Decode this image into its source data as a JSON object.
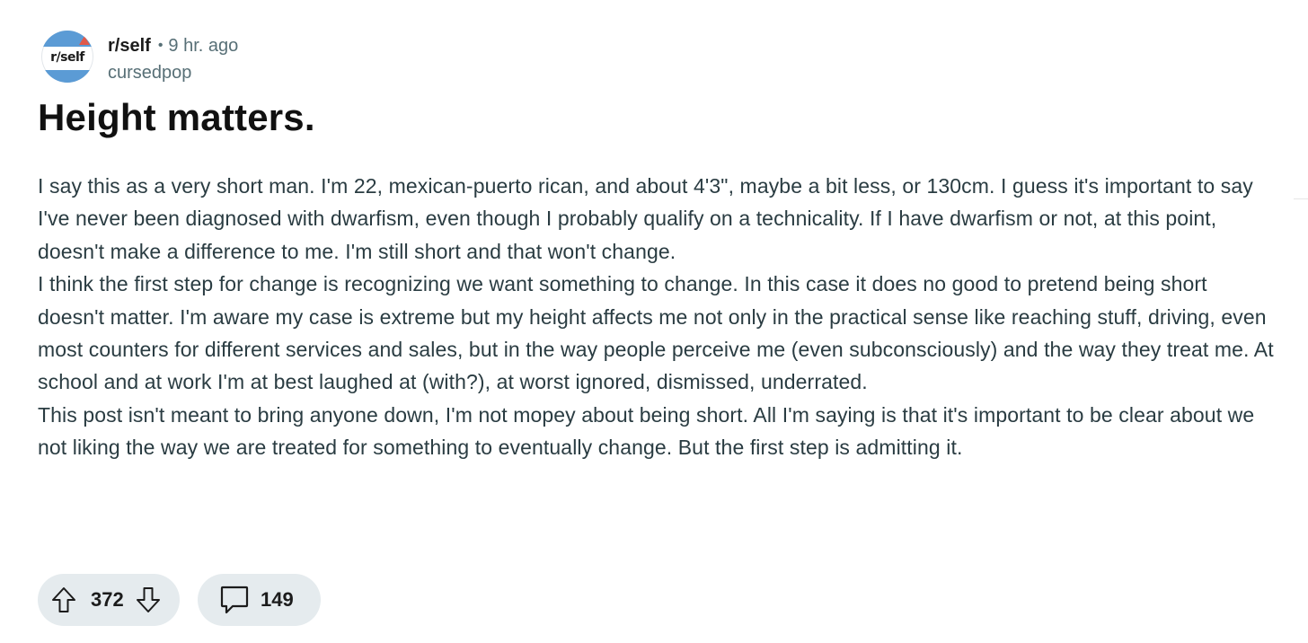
{
  "post": {
    "subreddit": "r/self",
    "avatar_text": "r/self",
    "separator": "•",
    "time_ago": "9 hr. ago",
    "author": "cursedpop",
    "title": "Height matters.",
    "body": [
      "I say this as a very short man. I'm 22, mexican-puerto rican, and about 4'3\", maybe a bit less, or 130cm. I guess it's important to say I've never been diagnosed with dwarfism, even though I probably qualify on a technicality. If I have dwarfism or not, at this point, doesn't make a difference to me. I'm still short and that won't change.",
      "I think the first step for change is recognizing we want something to change. In this case it does no good to pretend being short doesn't matter. I'm aware my case is extreme but my height affects me not only in the practical sense like reaching stuff, driving, even most counters for different services and sales, but in the way people perceive me (even subconsciously) and the way they treat me. At school and at work I'm at best laughed at (with?), at worst ignored, dismissed, underrated.",
      "This post isn't meant to bring anyone down, I'm not mopey about being short. All I'm saying is that it's important to be clear about we not liking the way we are treated for something to eventually change. But the first step is admitting it."
    ]
  },
  "actions": {
    "vote_count": "372",
    "comment_count": "149",
    "upvote_icon": "upvote-arrow-icon",
    "downvote_icon": "downvote-arrow-icon",
    "comment_icon": "comment-bubble-icon"
  },
  "colors": {
    "pill_background": "#e5ebee",
    "meta_text": "#576f76",
    "body_text": "#2a3c42",
    "avatar_accent": "#5b9bd5"
  }
}
